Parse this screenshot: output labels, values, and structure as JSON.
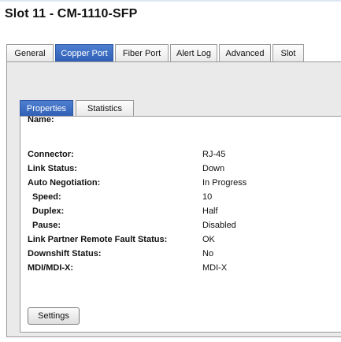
{
  "header": {
    "title": "Slot 11 - CM-1110-SFP"
  },
  "tabs": [
    {
      "label": "General",
      "active": false
    },
    {
      "label": "Copper Port",
      "active": true
    },
    {
      "label": "Fiber Port",
      "active": false
    },
    {
      "label": "Alert Log",
      "active": false
    },
    {
      "label": "Advanced",
      "active": false
    },
    {
      "label": "Slot",
      "active": false
    }
  ],
  "subtabs": [
    {
      "label": "Properties",
      "active": true
    },
    {
      "label": "Statistics",
      "active": false
    }
  ],
  "properties": {
    "name": {
      "label": "Name:",
      "value": ""
    },
    "connector": {
      "label": "Connector:",
      "value": "RJ-45"
    },
    "link_status": {
      "label": "Link Status:",
      "value": "Down"
    },
    "auto_negotiation": {
      "label": "Auto Negotiation:",
      "value": "In Progress"
    },
    "speed": {
      "label": "Speed:",
      "value": "10"
    },
    "duplex": {
      "label": "Duplex:",
      "value": "Half"
    },
    "pause": {
      "label": "Pause:",
      "value": "Disabled"
    },
    "remote_fault": {
      "label": "Link Partner Remote Fault Status:",
      "value": "OK"
    },
    "downshift": {
      "label": "Downshift Status:",
      "value": "No"
    },
    "mdi": {
      "label": "MDI/MDI-X:",
      "value": "MDI-X"
    }
  },
  "buttons": {
    "settings": "Settings"
  },
  "colors": {
    "active_tab": "#3a6bc4",
    "panel_bg": "#eaeaea"
  }
}
